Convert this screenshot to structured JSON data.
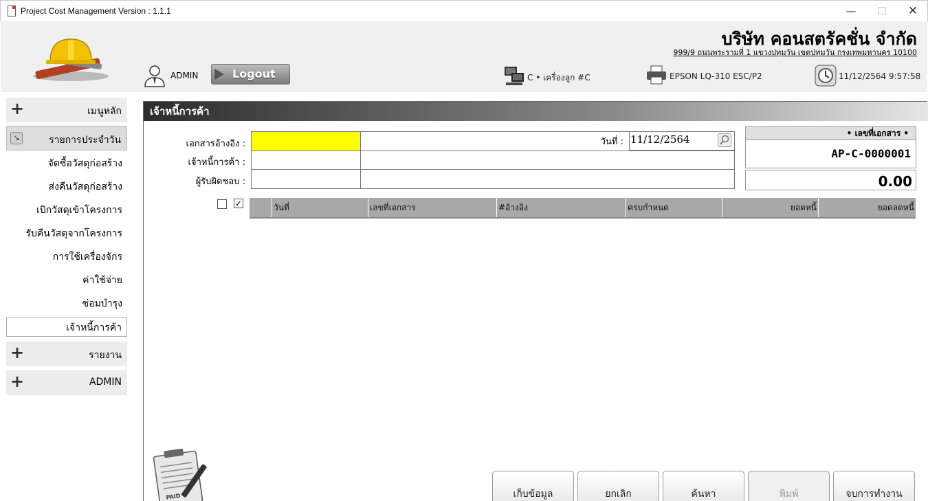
{
  "window": {
    "title": "Project Cost Management Version : 1.1.1",
    "minimize": "—",
    "maximize": "☐",
    "close": "✕"
  },
  "header": {
    "company_name": "บริษัท คอนสตรัคชั่น จำกัด",
    "company_address": "999/9 ถนนพระรามที่ 1 แขวงปทุมวัน เขตปทุมวัน กรุงเทพมหานคร 10100",
    "user": "ADMIN",
    "logout_label": "Logout",
    "computer": "C • เครื่องลูก #C",
    "printer": "EPSON LQ-310 ESC/P2",
    "datetime": "11/12/2564 9:57:58"
  },
  "sidebar": {
    "main_menu": "เมนูหลัก",
    "daily": "รายการประจำวัน",
    "items": [
      "จัดซื้อวัสดุก่อสร้าง",
      "ส่งคืนวัสดุก่อสร้าง",
      "เบิกวัสดุเข้าโครงการ",
      "รับคืนวัสดุจากโครงการ",
      "การใช้เครื่องจักร",
      "ค่าใช้จ่าย",
      "ซ่อมบำรุง",
      "เจ้าหนี้การค้า"
    ],
    "reports": "รายงาน",
    "admin": "ADMIN"
  },
  "main": {
    "title": "เจ้าหนี้การค้า",
    "form": {
      "ref_doc_label": "เอกสารอ้างอิง :",
      "creditor_label": "เจ้าหนี้การค้า :",
      "responsible_label": "ผู้รับผิดชอบ :",
      "date_label": "วันที่ :",
      "date_value": "11/12/2564"
    },
    "doc_panel": {
      "header": "• เลขที่เอกสาร •",
      "doc_no": "AP-C-0000001",
      "amount": "0.00"
    },
    "grid": {
      "columns": [
        "วันที่",
        "เลขที่เอกสาร",
        "#อ้างอิง",
        "ครบกำหนด",
        "ยอดหนี้",
        "ยอดลดหนี้"
      ],
      "check_mark": "✓"
    },
    "buttons": {
      "save": "เก็บข้อมูล",
      "cancel": "ยกเลิก",
      "search": "ค้นหา",
      "print": "พิมพ์",
      "exit": "จบการทำงาน"
    },
    "paid_stamp": "PAID"
  }
}
